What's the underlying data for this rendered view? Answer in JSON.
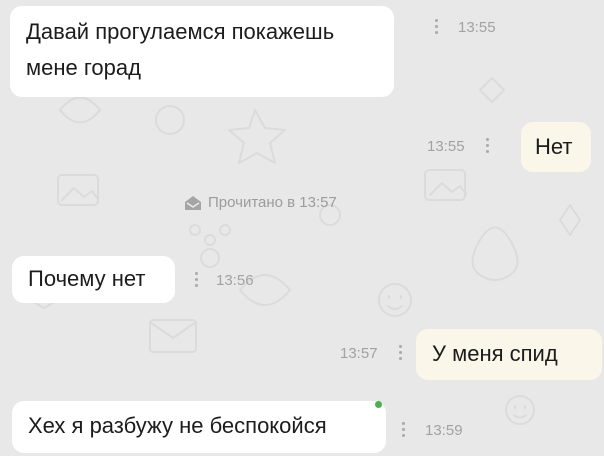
{
  "messages": [
    {
      "direction": "incoming",
      "text_line1": "Давай прогулаемся покажешь",
      "text_line2": "мене горад",
      "time": "13:55"
    },
    {
      "direction": "outgoing",
      "text": "Нет",
      "time": "13:55"
    },
    {
      "direction": "incoming",
      "text": "Почему нет",
      "time": "13:56"
    },
    {
      "direction": "outgoing",
      "text": "У меня спид",
      "time": "13:57"
    },
    {
      "direction": "incoming",
      "text": "Хех я разбужу не беспокойся",
      "time": "13:59"
    }
  ],
  "read_status": {
    "text": "Прочитано в 13:57",
    "icon": "envelope-open-icon"
  },
  "colors": {
    "background": "#e9e8e9",
    "incoming_bubble": "#ffffff",
    "outgoing_bubble": "#fbf6ea",
    "meta_text": "#a2a2a2",
    "online": "#4caf50"
  }
}
